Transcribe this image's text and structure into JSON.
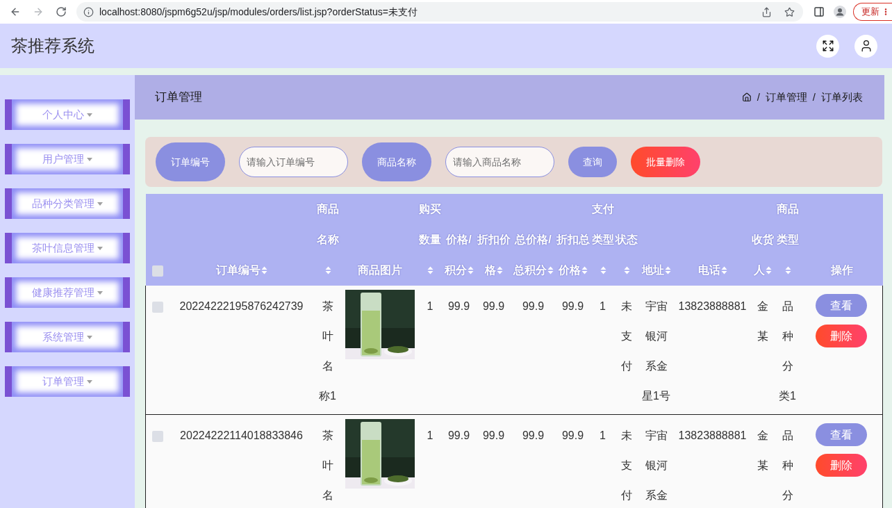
{
  "browser": {
    "url": "localhost:8080/jspm6g52u/jsp/modules/orders/list.jsp?orderStatus=未支付",
    "update_label": "更新"
  },
  "header": {
    "title": "茶推荐系统"
  },
  "sidebar": {
    "items": [
      {
        "label": "个人中心"
      },
      {
        "label": "用户管理"
      },
      {
        "label": "品种分类管理"
      },
      {
        "label": "茶叶信息管理"
      },
      {
        "label": "健康推荐管理"
      },
      {
        "label": "系统管理"
      },
      {
        "label": "订单管理"
      }
    ]
  },
  "breadcrumb": {
    "title": "订单管理",
    "separator": "/",
    "path": [
      "订单管理",
      "订单列表"
    ]
  },
  "search": {
    "fields": [
      {
        "label": "订单编号",
        "placeholder": "请输入订单编号"
      },
      {
        "label": "商品名称",
        "placeholder": "请输入商品名称"
      }
    ],
    "buttons": [
      {
        "label": "查询",
        "kind": "primary"
      },
      {
        "label": "批量删除",
        "kind": "danger"
      }
    ]
  },
  "table": {
    "select_all_checked": false,
    "columns": [
      {
        "label": "订单编号",
        "kind": "text",
        "sortable": true
      },
      {
        "label": "商品名称",
        "kind": "text",
        "sortable": true
      },
      {
        "label": "商品图片",
        "kind": "image",
        "sortable": false
      },
      {
        "label": "购买数量",
        "kind": "text",
        "sortable": true
      },
      {
        "label": "价格/积分",
        "kind": "text",
        "sortable": true
      },
      {
        "label": "折扣价格",
        "kind": "text",
        "sortable": true
      },
      {
        "label": "总价格/总积分",
        "kind": "text",
        "sortable": true
      },
      {
        "label": "折扣总价格",
        "kind": "text",
        "sortable": true
      },
      {
        "label": "支付类型",
        "kind": "text",
        "sortable": true
      },
      {
        "label": "状态",
        "kind": "text",
        "sortable": true
      },
      {
        "label": "地址",
        "kind": "text",
        "sortable": true
      },
      {
        "label": "电话",
        "kind": "text",
        "sortable": true
      },
      {
        "label": "收货人",
        "kind": "text",
        "sortable": true
      },
      {
        "label": "商品类型",
        "kind": "text",
        "sortable": true
      },
      {
        "label": "操作",
        "kind": "actions",
        "sortable": false
      }
    ],
    "rows": [
      {
        "checked": false,
        "cells": [
          "20224222195876242739",
          "茶叶名称1",
          "",
          "1",
          "99.9",
          "99.9",
          "99.9",
          "99.9",
          "1",
          "未支付",
          "宇宙银河系金星1号",
          "13823888881",
          "金某",
          "品种分类1"
        ],
        "actions": [
          {
            "label": "查看",
            "kind": "view"
          },
          {
            "label": "删除",
            "kind": "delete"
          }
        ]
      },
      {
        "checked": false,
        "cells": [
          "20224222114018833846",
          "茶叶名",
          "",
          "1",
          "99.9",
          "99.9",
          "99.9",
          "99.9",
          "1",
          "未支付",
          "宇宙银河系金",
          "13823888881",
          "金某",
          "品种分"
        ],
        "actions": [
          {
            "label": "查看",
            "kind": "view"
          },
          {
            "label": "删除",
            "kind": "delete"
          }
        ]
      }
    ]
  }
}
